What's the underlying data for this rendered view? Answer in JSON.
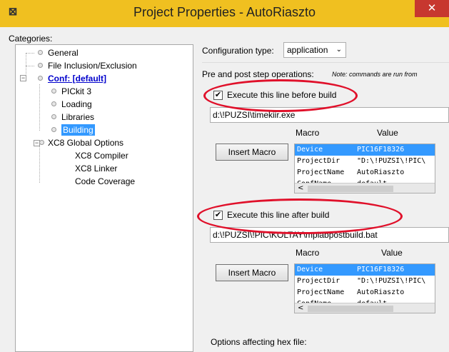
{
  "window": {
    "title": "Project Properties - AutoRiaszto",
    "close_glyph": "✕",
    "app_icon": "netbeans-icon"
  },
  "categories": {
    "label": "Categories:",
    "items": [
      {
        "label": "General"
      },
      {
        "label": "File Inclusion/Exclusion"
      },
      {
        "label": "Conf: [default]"
      },
      {
        "label": "PICkit 3"
      },
      {
        "label": "Loading"
      },
      {
        "label": "Libraries"
      },
      {
        "label": "Building"
      },
      {
        "label": "XC8 Global Options"
      },
      {
        "label": "XC8 Compiler"
      },
      {
        "label": "XC8 Linker"
      },
      {
        "label": "Code Coverage"
      }
    ]
  },
  "config": {
    "type_label": "Configuration type:",
    "type_value": "application"
  },
  "prepost": {
    "label": "Pre and post step operations:",
    "note": "Note: commands are run from",
    "before": {
      "checked": true,
      "label": "Execute this line before build",
      "command": "d:\\!PUZSI\\timekiir.exe",
      "button": "Insert Macro",
      "macro_header": "Macro",
      "value_header": "Value",
      "rows": [
        {
          "k": "Device",
          "v": "PIC16F18326"
        },
        {
          "k": "ProjectDir",
          "v": "\"D:\\!PUZSI\\!PIC\\"
        },
        {
          "k": "ProjectName",
          "v": "AutoRiaszto"
        },
        {
          "k": "ConfName",
          "v": "default"
        }
      ]
    },
    "after": {
      "checked": true,
      "label": "Execute this line after build",
      "command": "d:\\!PUZSI\\!PIC\\KOLTAY\\mplabpostbuild.bat",
      "button": "Insert Macro",
      "macro_header": "Macro",
      "value_header": "Value",
      "rows": [
        {
          "k": "Device",
          "v": "PIC16F18326"
        },
        {
          "k": "ProjectDir",
          "v": "\"D:\\!PUZSI\\!PIC\\"
        },
        {
          "k": "ProjectName",
          "v": "AutoRiaszto"
        },
        {
          "k": "ConfName",
          "v": "default"
        }
      ]
    }
  },
  "hex": {
    "label": "Options affecting hex file:"
  },
  "colors": {
    "titlebar": "#f0c020",
    "close": "#c7372f",
    "selection": "#3399ff",
    "annotation": "#e0102a"
  }
}
